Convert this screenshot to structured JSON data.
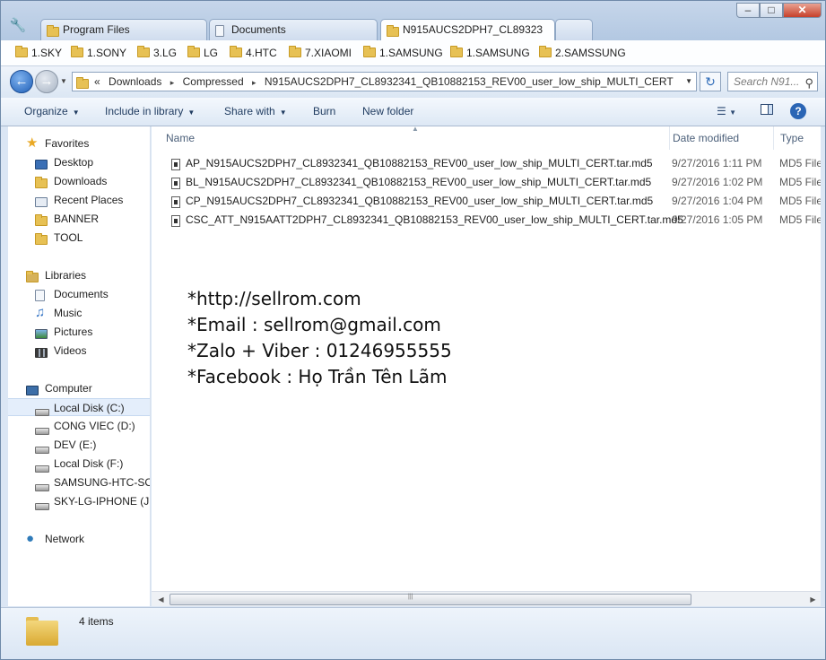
{
  "tabs": [
    {
      "label": "Program Files",
      "icon": "folder-icon",
      "active": false
    },
    {
      "label": "Documents",
      "icon": "document-icon",
      "active": false
    },
    {
      "label": "N915AUCS2DPH7_CL89323",
      "icon": "folder-icon",
      "active": true
    }
  ],
  "window_controls": {
    "minimize": "–",
    "maximize": "□",
    "close": "✕"
  },
  "favorites": [
    "1.SKY",
    "1.SONY",
    "3.LG",
    "LG",
    "4.HTC",
    "7.XIAOMI",
    "1.SAMSUNG",
    "1.SAMSUNG",
    "2.SAMSSUNG"
  ],
  "address": {
    "prefix": "«",
    "crumbs": [
      "Downloads",
      "Compressed",
      "N915AUCS2DPH7_CL8932341_QB10882153_REV00_user_low_ship_MULTI_CERT"
    ],
    "separator": "▸"
  },
  "search": {
    "placeholder": "Search N91..."
  },
  "commands": {
    "organize": "Organize",
    "include_in_library": "Include in library",
    "share_with": "Share with",
    "burn": "Burn",
    "new_folder": "New folder"
  },
  "nav": {
    "favorites_header": "Favorites",
    "favorites": [
      "Desktop",
      "Downloads",
      "Recent Places",
      "BANNER",
      "TOOL"
    ],
    "libraries_header": "Libraries",
    "libraries": [
      "Documents",
      "Music",
      "Pictures",
      "Videos"
    ],
    "computer_header": "Computer",
    "drives": [
      "Local Disk (C:)",
      "CONG VIEC (D:)",
      "DEV (E:)",
      "Local Disk (F:)",
      "SAMSUNG-HTC-SO",
      "SKY-LG-IPHONE (J:)"
    ],
    "network_header": "Network"
  },
  "columns": {
    "name": "Name",
    "date_modified": "Date modified",
    "type": "Type"
  },
  "files": [
    {
      "name": "AP_N915AUCS2DPH7_CL8932341_QB10882153_REV00_user_low_ship_MULTI_CERT.tar.md5",
      "date": "9/27/2016 1:11 PM",
      "type": "MD5 File"
    },
    {
      "name": "BL_N915AUCS2DPH7_CL8932341_QB10882153_REV00_user_low_ship_MULTI_CERT.tar.md5",
      "date": "9/27/2016 1:02 PM",
      "type": "MD5 File"
    },
    {
      "name": "CP_N915AUCS2DPH7_CL8932341_QB10882153_REV00_user_low_ship_MULTI_CERT.tar.md5",
      "date": "9/27/2016 1:04 PM",
      "type": "MD5 File"
    },
    {
      "name": "CSC_ATT_N915AATT2DPH7_CL8932341_QB10882153_REV00_user_low_ship_MULTI_CERT.tar.md5",
      "date": "9/27/2016 1:05 PM",
      "type": "MD5 File"
    }
  ],
  "overlay_lines": [
    "*http://sellrom.com",
    "*Email : sellrom@gmail.com",
    "*Zalo + Viber : 01246955555",
    "*Facebook : Họ Trần Tên Lãm"
  ],
  "status": {
    "item_count": "4 items"
  },
  "colors": {
    "accent": "#2a65b5",
    "selection": "#e4eefb",
    "folder": "#e7c154"
  }
}
